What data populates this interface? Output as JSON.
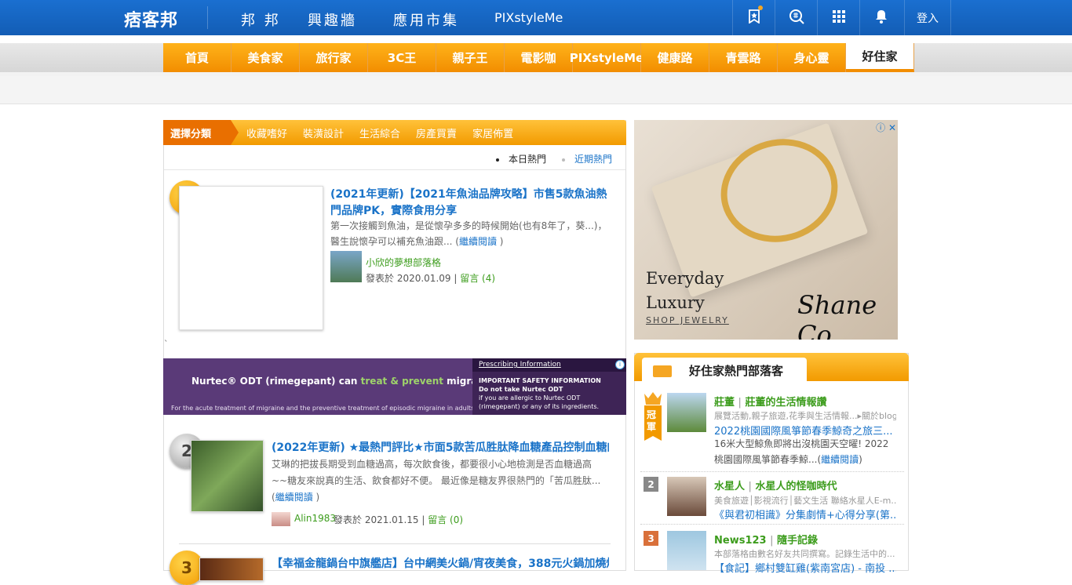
{
  "header": {
    "logo": "痞客邦",
    "nav": [
      "邦 邦",
      "興趣牆",
      "應用市集",
      "PIXstyleMe"
    ],
    "login": "登入"
  },
  "channels": [
    "首頁",
    "美食家",
    "旅行家",
    "3C王",
    "親子王",
    "電影咖",
    "PIXstyleMe",
    "健康路",
    "青雲路",
    "身心靈",
    "好住家"
  ],
  "category": {
    "label": "選擇分類",
    "links": [
      "收藏嗜好",
      "裝潢設計",
      "生活綜合",
      "房產買賣",
      "家居佈置"
    ]
  },
  "tabs": [
    "本日熱門",
    "近期熱門"
  ],
  "posts": [
    {
      "rank": "1",
      "title": "(2021年更新)【2021年魚油品牌攻略】市售5款魚油熱門品牌PK，實際食用分享",
      "excerpt": "第一次接觸到魚油，是從懷孕多多的時候開始(也有8年了，葵...)，醫生說懷孕可以補充魚油跟...",
      "more": "繼續閱讀",
      "author": "小欣的夢想部落格",
      "meta": "發表於 2020.01.09 |",
      "comments": "留言 (4)"
    },
    {
      "rank": "2",
      "title": "(2022年更新) ★最熱門評比★市面5款苦瓜胜肽降血糖產品控制血糖的...",
      "excerpt": "艾琳的把拔長期受到血糖過高，每次飲食後，都要很小心地檢測是否血糖過高~~糖友來說真的生活、飲食都好不便。 最近像是糖友界很熱門的「苦瓜胜肽...",
      "more": "繼續閱讀",
      "author": "Alin1983",
      "meta": "發表於 2021.01.15 |",
      "comments": "留言 (0)"
    },
    {
      "rank": "3",
      "title": "【幸福金龍鍋台中旗艦店】台中網美火鍋/宵夜美食，388元火鍋加燒烤..."
    }
  ],
  "ad_banner": {
    "main_pre": "Nurtec® ODT (rimegepant) can ",
    "main_hl": "treat & prevent",
    "main_post": " migraines",
    "sub": "For the acute treatment of migraine and the preventive treatment of episodic migraine in adults.",
    "panel_head": "Prescribing Information",
    "panel_title": "IMPORTANT SAFETY INFORMATION",
    "panel_line1": "Do not take Nurtec ODT",
    "panel_line2": "if you are allergic to Nurtec ODT",
    "panel_line3": "(rimegepant) or any of its ingredients."
  },
  "side_ad": {
    "copy1": "Everyday",
    "copy2": "Luxury",
    "shop": "SHOP JEWELRY",
    "brand": "Shane Co."
  },
  "hot": {
    "title": "好住家熱門部落客",
    "crown_text": "冠軍",
    "items": [
      {
        "rank": "1",
        "name": "莊董",
        "blog": "莊董的生活情報讚",
        "desc": "展覽活動,親子旅遊,花季與生活情報...▸關於blog...",
        "post": "2022桃園國際風箏節春季鯨奇之旅三...",
        "excerpt": "16米大型鯨魚即將出沒桃園天空曜! 2022桃園國際風箏節春季鯨...",
        "more": "繼續閱讀"
      },
      {
        "rank": "2",
        "name": "水星人",
        "blog": "水星人的怪咖時代",
        "desc": "美食旅遊│影視流行│藝文生活 聯絡水星人E-m...",
        "post": "《與君初相識》分集劇情+心得分享(第..."
      },
      {
        "rank": "3",
        "name": "News123",
        "blog": "隨手記錄",
        "desc": "本部落格由數名好友共同撰寫。記錄生活中的...",
        "post": "【食記】鄉村雙缸雞(紫南宮店) - 南投 ..."
      }
    ]
  },
  "colors": {
    "brand_blue": "#1565c0",
    "accent_orange": "#f29a00",
    "link_blue": "#1a73c8",
    "author_green": "#3c9c1c"
  }
}
